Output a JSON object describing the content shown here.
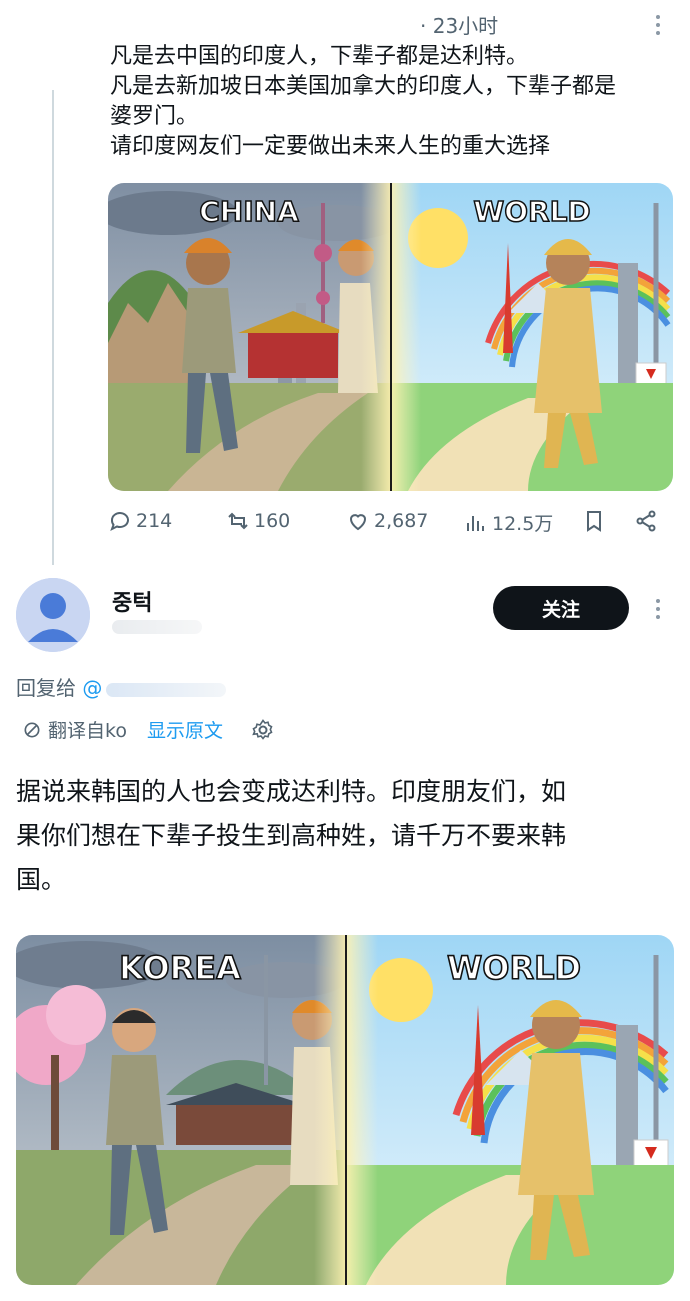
{
  "post1": {
    "time": "· 23小时",
    "lines": [
      "凡是去中国的印度人，下辈子都是达利特。",
      "凡是去新加坡日本美国加拿大的印度人，下辈子都是",
      "婆罗门。",
      "请印度网友们一定要做出未来人生的重大选择"
    ],
    "image": {
      "left_label": "CHINA",
      "right_label": "WORLD"
    },
    "actions": {
      "replies": "214",
      "reposts": "160",
      "likes": "2,687",
      "views": "12.5万"
    }
  },
  "reply": {
    "username": "중턱",
    "follow_label": "关注",
    "reply_to_label": "回复给",
    "reply_to_at": "@",
    "translated_from": "翻译自ko",
    "show_original": "显示原文",
    "lines": [
      "据说来韩国的人也会变成达利特。印度朋友们，如",
      "果你们想在下辈子投生到高种姓，请千万不要来韩",
      "国。"
    ],
    "image": {
      "left_label": "KOREA",
      "right_label": "WORLD"
    }
  },
  "colors": {
    "text": "#0f1419",
    "muted": "#536471",
    "link": "#1d9bf0",
    "follow_bg": "#0f1419"
  }
}
